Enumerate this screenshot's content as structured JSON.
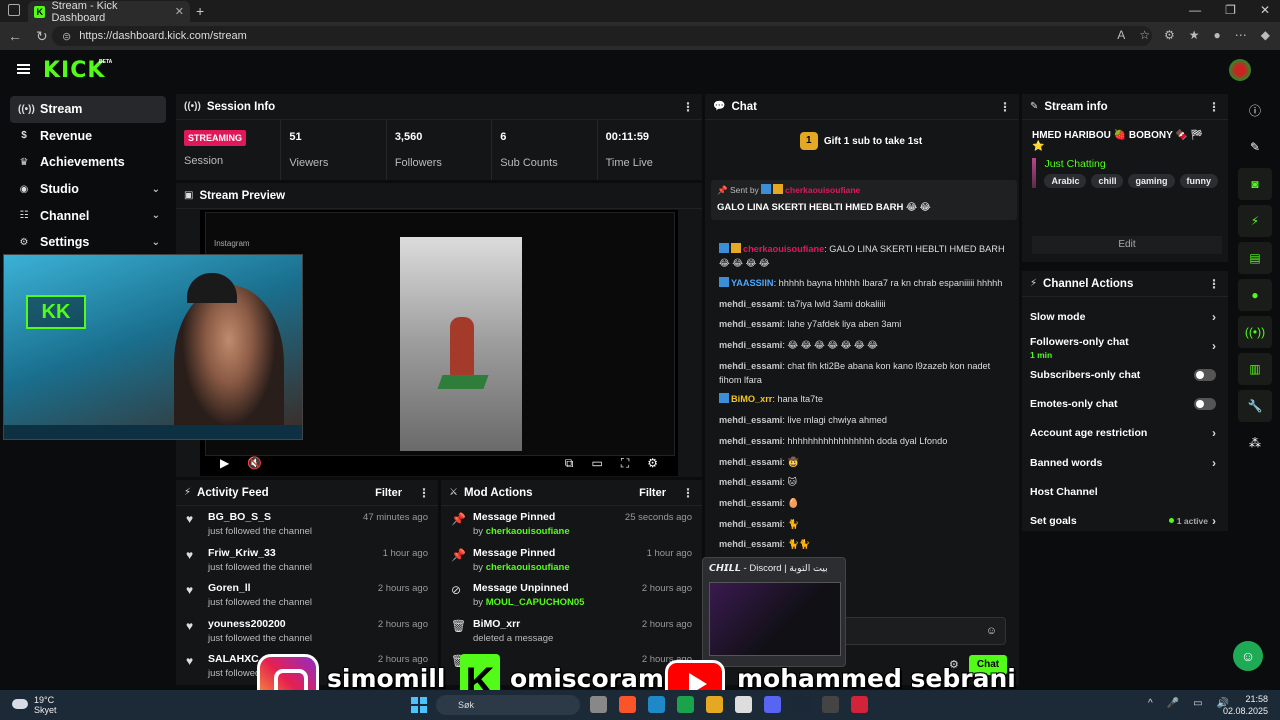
{
  "browser": {
    "tab_title": "Stream - Kick Dashboard",
    "url": "https://dashboard.kick.com/stream"
  },
  "app": {
    "logo": "KICK",
    "beta": "BETA"
  },
  "sidebar": {
    "items": [
      {
        "label": "Stream",
        "icon": "broadcast-icon"
      },
      {
        "label": "Revenue",
        "icon": "dollar-icon"
      },
      {
        "label": "Achievements",
        "icon": "trophy-icon"
      },
      {
        "label": "Studio",
        "icon": "studio-icon"
      },
      {
        "label": "Channel",
        "icon": "channel-icon"
      },
      {
        "label": "Settings",
        "icon": "gear-icon"
      }
    ]
  },
  "session": {
    "title": "Session Info",
    "status": "STREAMING",
    "status_label": "Session",
    "viewers": "51",
    "viewers_label": "Viewers",
    "followers": "3,560",
    "followers_label": "Followers",
    "subs": "6",
    "subs_label": "Sub Counts",
    "time": "00:11:59",
    "time_label": "Time Live"
  },
  "preview": {
    "title": "Stream Preview",
    "ig_label": "Instagram"
  },
  "activity": {
    "title": "Activity Feed",
    "filter": "Filter",
    "rows": [
      {
        "name": "BG_BO_S_S",
        "sub": "just followed the channel",
        "time": "47 minutes ago"
      },
      {
        "name": "Friw_Kriw_33",
        "sub": "just followed the channel",
        "time": "1 hour ago"
      },
      {
        "name": "Goren_ll",
        "sub": "just followed the channel",
        "time": "2 hours ago"
      },
      {
        "name": "youness200200",
        "sub": "just followed the channel",
        "time": "2 hours ago"
      },
      {
        "name": "SALAHXC",
        "sub": "just followed",
        "time": "2 hours ago"
      }
    ]
  },
  "mod": {
    "title": "Mod Actions",
    "filter": "Filter",
    "rows": [
      {
        "action": "Message Pinned",
        "by": "by",
        "user": "cherkaouisoufiane",
        "time": "25 seconds ago"
      },
      {
        "action": "Message Pinned",
        "by": "by",
        "user": "cherkaouisoufiane",
        "time": "1 hour ago"
      },
      {
        "action": "Message Unpinned",
        "by": "by",
        "user": "MOUL_CAPUCHON05",
        "time": "2 hours ago"
      },
      {
        "action": "BiMO_xrr",
        "by": "deleted a message",
        "user": "",
        "time": "2 hours ago"
      },
      {
        "action": "oram",
        "by": "",
        "user": "",
        "time": "2 hours ago"
      }
    ]
  },
  "chat": {
    "title": "Chat",
    "gift": "Gift 1 sub to take 1st",
    "pinned_by": "Sent by",
    "pinned_user": "cherkaouisoufiane",
    "pinned_msg": "GALO LINA SKERTI HEBLTI HMED BARH 😂 😂",
    "messages": [
      {
        "user": "cherkaouisoufiane",
        "text": ": GALO LINA SKERTI HEBLTI HMED BARH 😂 😂 😂 😂"
      },
      {
        "user": "YAASSIIN",
        "text": ": hhhhh bayna hhhhh lbara7 ra kn chrab espaniiiii hhhhh"
      },
      {
        "user": "mehdi_essami",
        "text": ": ta7iya lwld 3ami dokaliiii"
      },
      {
        "user": "mehdi_essami",
        "text": ": lahe y7afdek liya aben 3ami"
      },
      {
        "user": "mehdi_essami",
        "text": ": 😂 😂 😂 😂 😂 😂 😂"
      },
      {
        "user": "mehdi_essami",
        "text": ": chat fih kti2Be abana kon kano l9zazeb kon nadet fihom lfara"
      },
      {
        "user": "BiMO_xrr",
        "text": ": hana lta7te"
      },
      {
        "user": "mehdi_essami",
        "text": ": live mlagi chwiya ahmed"
      },
      {
        "user": "mehdi_essami",
        "text": ": hhhhhhhhhhhhhhhhh doda dyal Lfondo"
      },
      {
        "user": "mehdi_essami",
        "text": ":"
      },
      {
        "user": "mehdi_essami",
        "text": ":"
      },
      {
        "user": "mehdi_essami",
        "text": ":"
      },
      {
        "user": "mehdi_essami",
        "text": ":"
      },
      {
        "user": "mehdi_essami",
        "text": ":"
      }
    ],
    "send": "Chat"
  },
  "discord": {
    "title": "𝘾𝙃𝙄𝙇𝙇 - Discord | بيت التوبة"
  },
  "stream_info": {
    "title": "Stream info",
    "stream_title": "HMED HARIBOU 🍓 BOBONY 🍫 🏁 ⭐",
    "category": "Just Chatting",
    "tags": [
      "Arabic",
      "chill",
      "gaming",
      "funny"
    ],
    "edit": "Edit"
  },
  "channel_actions": {
    "title": "Channel Actions",
    "rows": [
      {
        "label": "Slow mode",
        "kind": "chevron"
      },
      {
        "label": "Followers-only chat",
        "sub": "1 min",
        "kind": "chevron"
      },
      {
        "label": "Subscribers-only chat",
        "kind": "toggle"
      },
      {
        "label": "Emotes-only chat",
        "kind": "toggle"
      },
      {
        "label": "Account age restriction",
        "kind": "chevron"
      },
      {
        "label": "Banned words",
        "kind": "chevron"
      },
      {
        "label": "Host Channel",
        "kind": "none"
      },
      {
        "label": "Set goals",
        "active": "1 active",
        "kind": "chevron"
      }
    ]
  },
  "overlay": {
    "ig_name": "simomill",
    "kick_name": "omiscoram",
    "yt_name": "mohammed sebrani"
  },
  "taskbar": {
    "temp": "19°C",
    "weather": "Skyet",
    "search": "Søk",
    "time": "21:58",
    "date": "02.08.2025"
  },
  "colors": {
    "kick_green": "#53fc18",
    "streaming_red": "#e0185a",
    "panel": "#141517"
  }
}
